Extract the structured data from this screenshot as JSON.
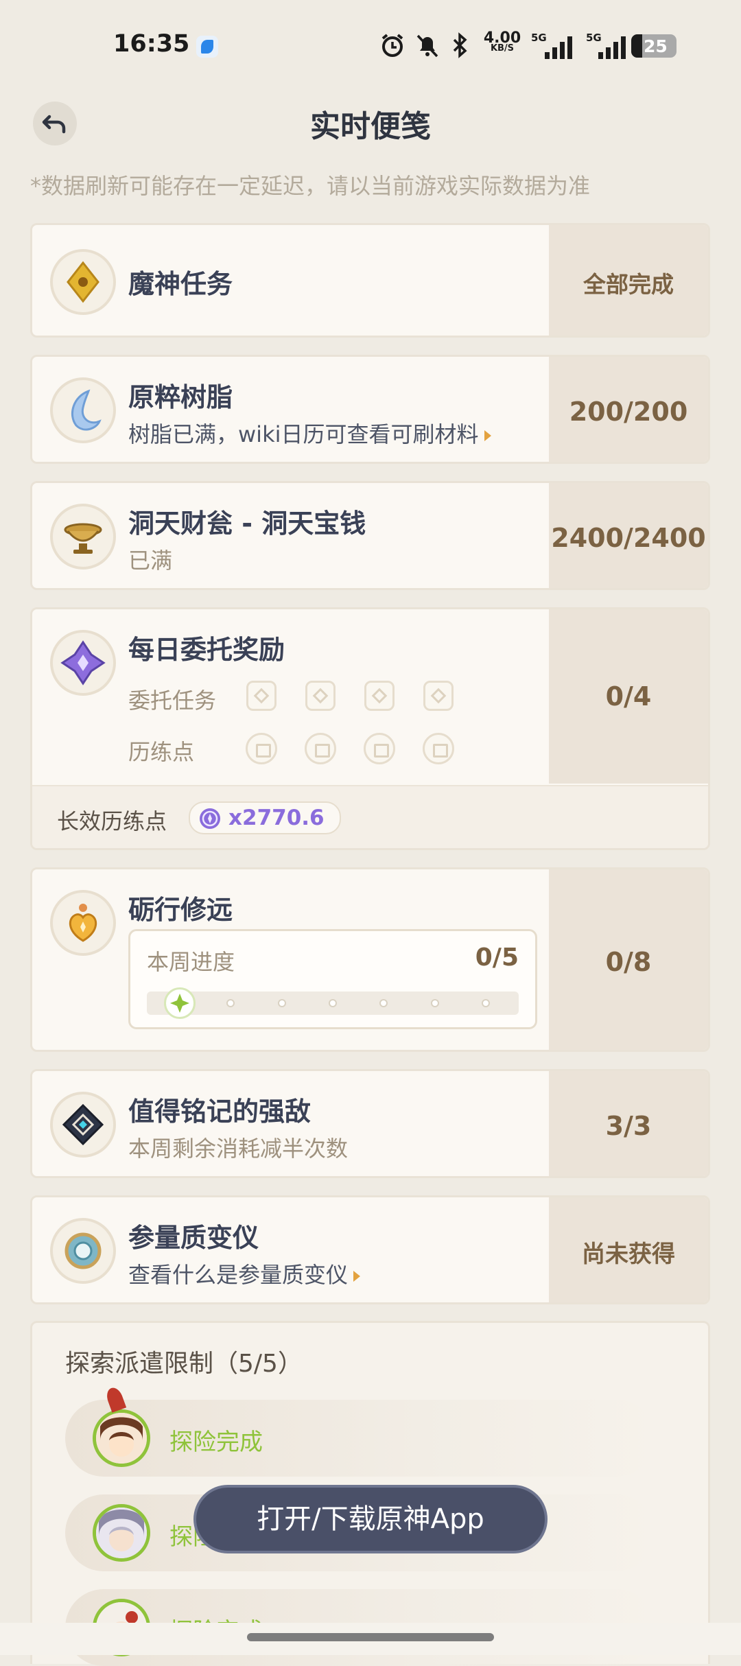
{
  "status_bar": {
    "time": "16:35",
    "net_speed_value": "4.00",
    "net_speed_unit": "KB/S",
    "net1": "5G",
    "net2": "5G",
    "battery": "25",
    "icons": [
      "app-icon",
      "alarm-icon",
      "mute-icon",
      "bluetooth-icon",
      "signal-icon",
      "signal-icon",
      "battery-icon"
    ]
  },
  "header": {
    "title": "实时便笺",
    "notice": "*数据刷新可能存在一定延迟，请以当前游戏实际数据为准"
  },
  "cards": {
    "archon_quest": {
      "title": "魔神任务",
      "status": "全部完成"
    },
    "resin": {
      "title": "原粹树脂",
      "subtitle": "树脂已满，wiki日历可查看可刷材料",
      "value": "200/200"
    },
    "realm_currency": {
      "title": "洞天财瓮 - 洞天宝钱",
      "subtitle": "已满",
      "value": "2400/2400"
    },
    "daily": {
      "title": "每日委托奖励",
      "commission_label": "委托任务",
      "training_label": "历练点",
      "value": "0/4",
      "long_training_label": "长效历练点",
      "long_training_value": "x2770.6"
    },
    "weekly": {
      "title": "砺行修远",
      "progress_label": "本周进度",
      "progress_value": "0/5",
      "progress_current": 1,
      "progress_total": 7,
      "value": "0/8"
    },
    "boss": {
      "title": "值得铭记的强敌",
      "subtitle": "本周剩余消耗减半次数",
      "value": "3/3"
    },
    "transformer": {
      "title": "参量质变仪",
      "subtitle": "查看什么是参量质变仪",
      "status": "尚未获得"
    }
  },
  "expedition": {
    "title": "探索派遣限制（5/5）",
    "rows": [
      {
        "label": "探险完成"
      },
      {
        "label": "探险完成"
      },
      {
        "label": "探险完成"
      }
    ]
  },
  "open_app_button": "打开/下载原神App",
  "colors": {
    "accent_green": "#8fc33b",
    "value_brown": "#7b6243",
    "purple": "#8a6cdc"
  }
}
